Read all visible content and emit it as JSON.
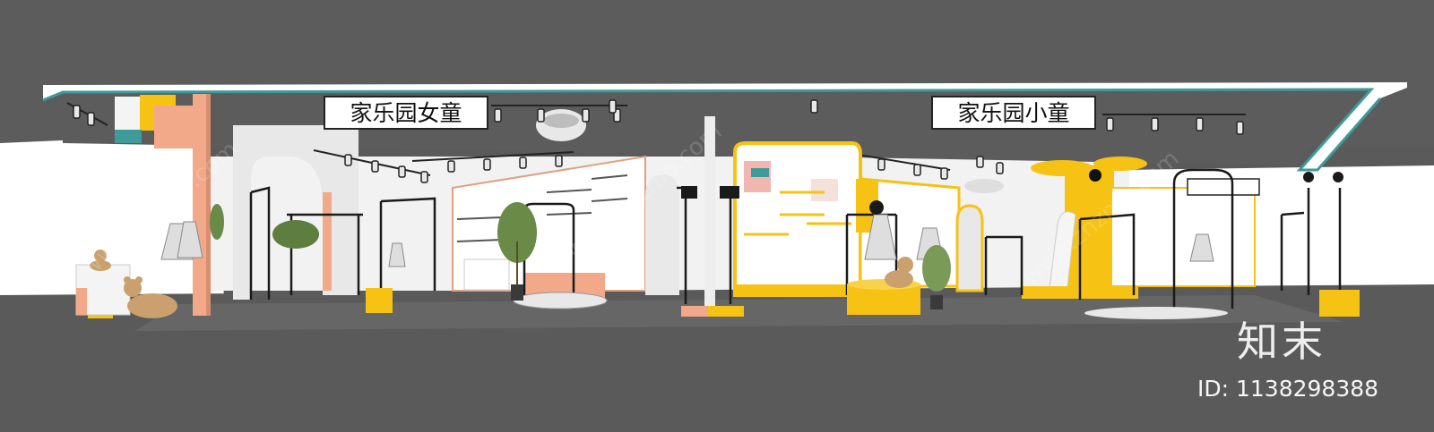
{
  "signs": {
    "left": "家乐园女童",
    "right": "家乐园小童"
  },
  "watermark": {
    "logo_text": "知末",
    "id_label": "ID: 1138298388",
    "diagonal": "www.znzmo.com"
  },
  "colors": {
    "ceiling": "#5c5c5c",
    "floor": "#5a5a5a",
    "wall": "#ffffff",
    "accent_yellow": "#f6c214",
    "accent_peach": "#f2a98a",
    "teal_trim": "#3f9a9a",
    "rack_black": "#1a1a1a"
  },
  "icons": [
    "track-spotlight-icon",
    "teddy-bear-icon",
    "dress-mannequin-icon",
    "potted-plant-icon"
  ]
}
